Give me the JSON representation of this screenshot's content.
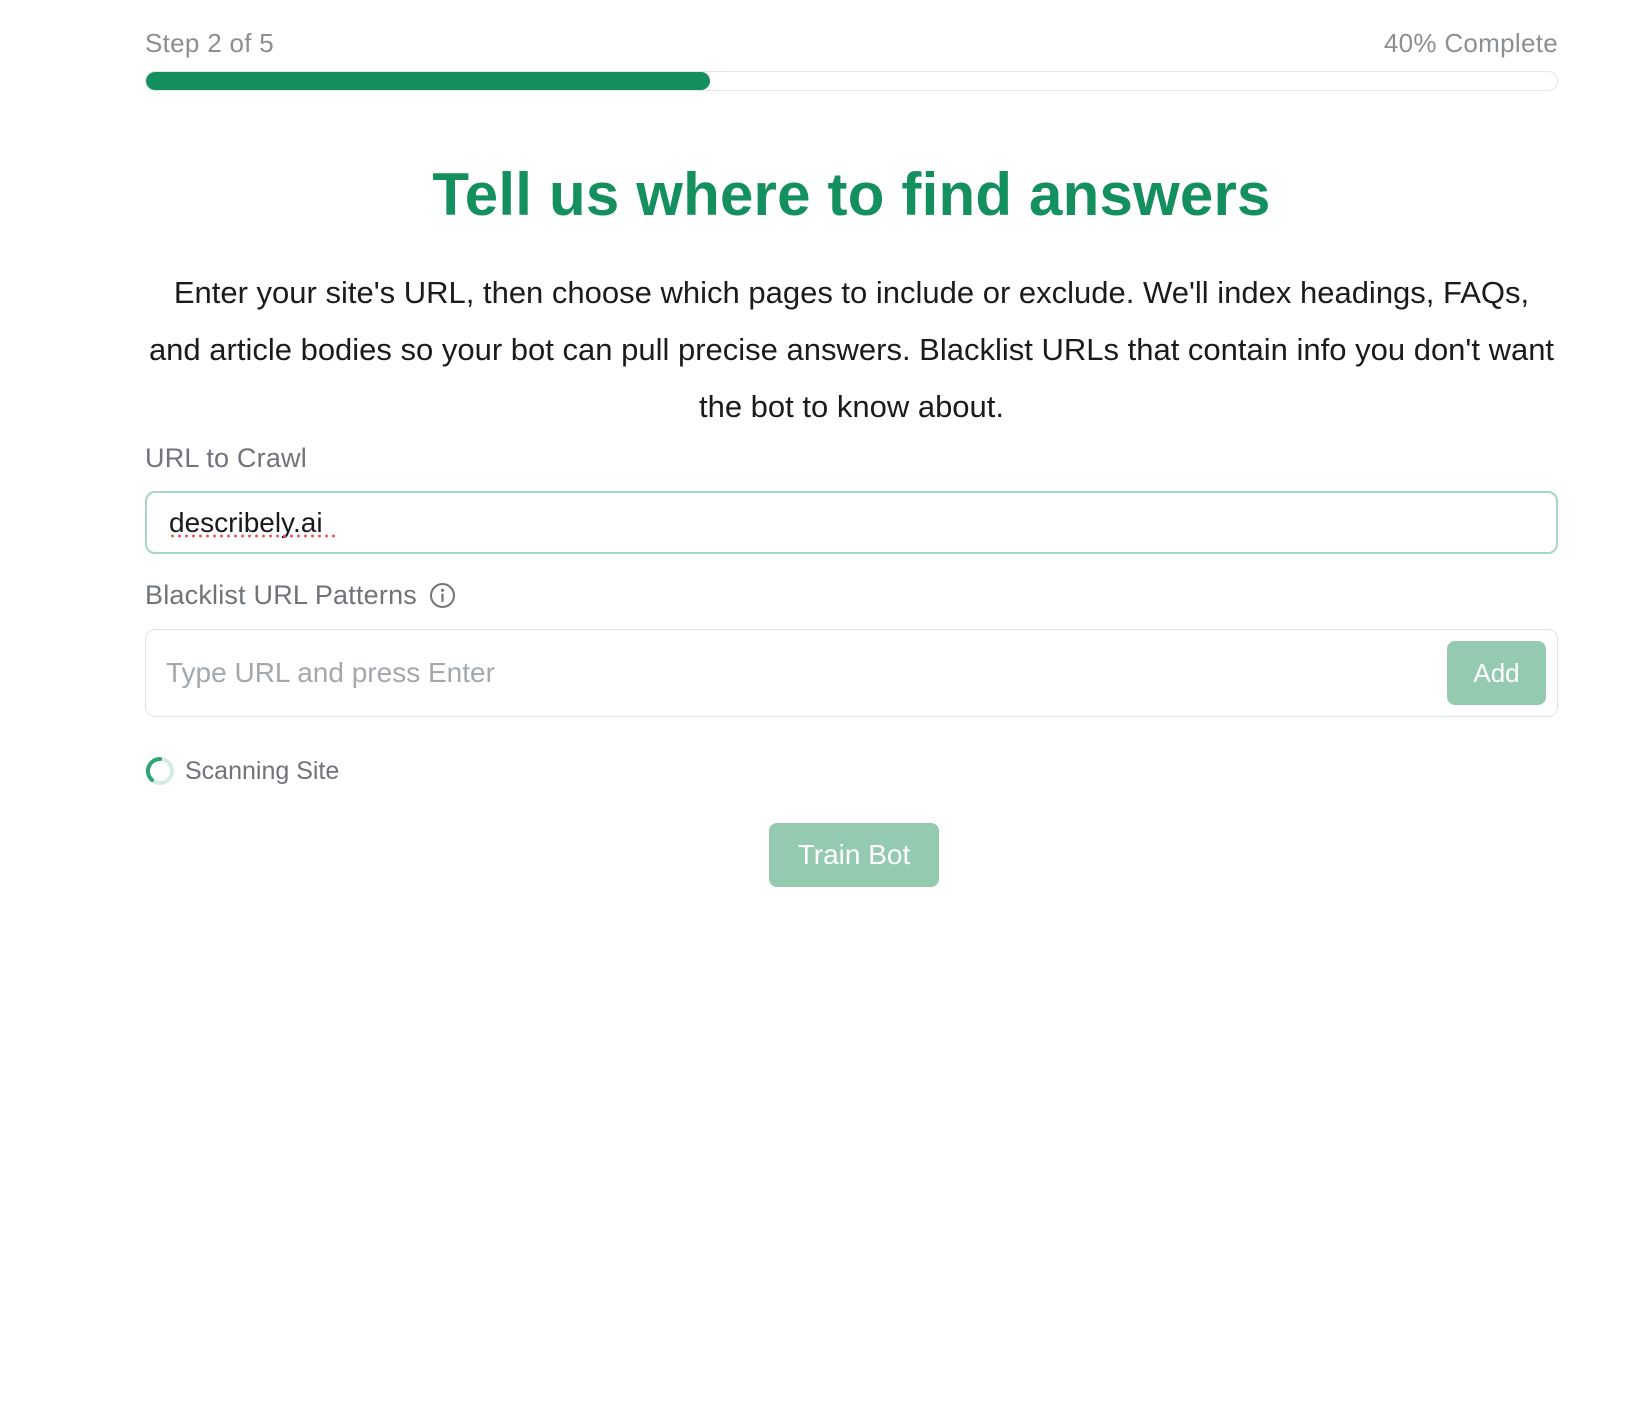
{
  "progress": {
    "step_label": "Step 2 of 5",
    "percent_label": "40% Complete",
    "percent": 40,
    "fill_color": "#148f5e"
  },
  "header": {
    "title": "Tell us where to find answers",
    "description": "Enter your site's URL, then choose which pages to include or exclude. We'll index headings, FAQs, and article bodies so your bot can pull precise answers. Blacklist URLs that contain info you don't want the bot to know about."
  },
  "url_field": {
    "label": "URL to Crawl",
    "value": "describely.ai"
  },
  "blacklist": {
    "label": "Blacklist URL Patterns",
    "info_icon": "info-icon",
    "placeholder": "Type URL and press Enter",
    "add_label": "Add"
  },
  "status": {
    "icon": "spinner-icon",
    "text": "Scanning Site"
  },
  "actions": {
    "train_label": "Train Bot",
    "button_color": "#94cbb0"
  }
}
